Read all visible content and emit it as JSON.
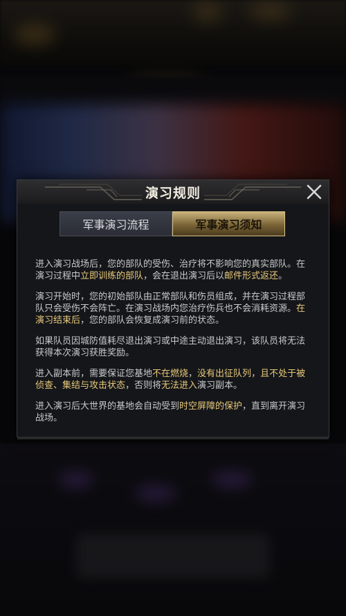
{
  "dialog": {
    "title": "演习规则",
    "close_icon": "close-icon"
  },
  "tabs": [
    {
      "label": "军事演习流程",
      "active": false
    },
    {
      "label": "军事演习须知",
      "active": true
    }
  ],
  "colors": {
    "highlight": "#e9c97a",
    "body_text": "#c9c9c9",
    "title_text": "#f3eee2"
  },
  "paragraphs": [
    [
      {
        "t": "进入演习战场后，您的部队的受伤、治疗将不影响您的真实部队。在演习过程中",
        "hl": false
      },
      {
        "t": "立即训练的部队",
        "hl": true
      },
      {
        "t": "，会在退出演习后以",
        "hl": false
      },
      {
        "t": "邮件形式返还",
        "hl": true
      },
      {
        "t": "。",
        "hl": false
      }
    ],
    [
      {
        "t": "演习开始时，您的初始部队由正常部队和伤员组成，并在演习过程部队只会受伤不会阵亡。在演习战场内您治疗伤兵也不会消耗资源。",
        "hl": false
      },
      {
        "t": "在演习结束后",
        "hl": true
      },
      {
        "t": "，您的部队会恢复成演习前的状态。",
        "hl": false
      }
    ],
    [
      {
        "t": "如果队员因城防值耗尽退出演习或中途主动退出演习，该队员将无法获得本次演习获胜奖励。",
        "hl": false
      }
    ],
    [
      {
        "t": "进入副本前，需要保证您基地",
        "hl": false
      },
      {
        "t": "不在燃烧",
        "hl": true
      },
      {
        "t": "，",
        "hl": false
      },
      {
        "t": "没有出征队列",
        "hl": true
      },
      {
        "t": "，",
        "hl": false
      },
      {
        "t": "且不处于被侦查、集结与攻击状态",
        "hl": true
      },
      {
        "t": "，否则将",
        "hl": false
      },
      {
        "t": "无法进入",
        "hl": true
      },
      {
        "t": "演习副本。",
        "hl": false
      }
    ],
    [
      {
        "t": "进入演习后大世界的基地会自动受到",
        "hl": false
      },
      {
        "t": "时空屏障的保护",
        "hl": true
      },
      {
        "t": "，直到离开演习战场。",
        "hl": false
      }
    ]
  ]
}
